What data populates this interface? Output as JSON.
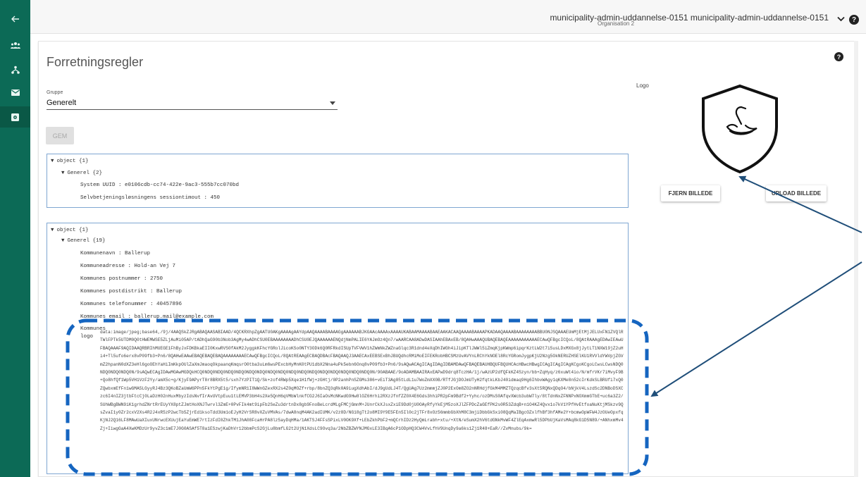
{
  "header": {
    "user_name": "municipality-admin-uddannelse-0151 municipality-admin-uddannelse-0151",
    "organisation": "Organisation 2",
    "help_label": "?"
  },
  "nav": {
    "items": [
      {
        "icon": "back-arrow-icon"
      },
      {
        "icon": "users-icon"
      },
      {
        "icon": "org-tree-icon"
      },
      {
        "icon": "mail-icon"
      },
      {
        "icon": "settings-icon",
        "active": true
      }
    ]
  },
  "page": {
    "title": "Forretningsregler",
    "help_label": "?",
    "group_label": "Gruppe",
    "group_value": "Generelt",
    "save_label": "GEM"
  },
  "panel1": {
    "root": "object {1}",
    "group": "Generel {2}",
    "rows": [
      "System UUID :  e0106cdb-cc74-422e-9ac3-555b7cc070bd",
      "Selvbetjeningsløsningens sessiontimout : 450"
    ]
  },
  "panel2": {
    "root": "object {1}",
    "group": "Generel {19}",
    "rows": [
      "Kommunenavn : Ballerup",
      "Kommuneadresse : Hold-an Vej 7",
      "Kommunes postnummer : 2750",
      "Kommunes postdistrikt : Ballerup",
      "Kommunes telefonummer : 40457896",
      "Kommunes email : ballerup.mail@example.com"
    ],
    "logo_key": "Kommunes logo",
    "logo_value": "data:image/jpeg;base64,/9j/4AAQSkZJRgABAQAASABIAAD/4QCKRXhpZgAATU0AKgAAAAgAAYdpAAQAAAABAAAAGgAAAAAABJKGAAcAAAAxAAAAUKABAAMAAAABAAEAAKACAAQAAAABAAAAPKADAAQAAAABAAAAAAAABBU0NJSQAAAEUmMjEtMjJELUxFN1ZVQlRTWlFPTk5UTDM0Q0tHWEMWSE5ZLjAuMi05AP/tADhQaG90b3Nob3AgMy4wADhCSU0EBAAAAAAAADhCSU0EJQAAAAAAENQdjNmPALIE6YAJmOz4Qn7/wAARCAA8ADwDASIAAhEBAxEB/8QAHwAAAQUBAQEBAQEAAAAAAAAAAAECAwQFBgcICQoL/8QAtRAAAgEDAwIEAwUFBAQAAAF9AQIDAAQRBRIhMUEGE1FhByJxFDKBkaEII0KxwRVS0fAkM2JyggkKFhcYGRolJicoKSo0NTY3ODk6Q0RFRkdISUpTVFVWV1hZWmNkZWZnaGlqc3R1dnd4eXqDhIWGh4iJipKTlJWWl5iZmqKjpKWmp6ipqrKztLW2t7i5usLDxMXGx8jJytLT1NXW19jZ2uHi4+Tl5ufo6erx8vP09fb3+Pn6/8QAHwEAAwEBAQEBAQEBAQAAAAAAAAECAwQFBgcICQoL/8QAtREAAgECBAQDBAcFBAQAAQJ3AAECAxEEBSExBhJBUQdhcRMiMoEIFEKRobHBCSMzUvAVYnLRChYkNOEl8RcYGRomJygpKjU2Nzg5OkNERUZHSElKU1RVVldYWVpjZGVmZ2hpanN0dXZ3eHl6goOEhYaHiImKkpOUlZaXmJmaoqOkpaanqKmqsrO0tba3uLm6wsPExcbHyMnK0tPU1dbX2Nna4uPk5ebn6Onq8vP09fb3+Pn6/9sAQwACAgICAgIDAgIDBAMDAwQFBAQEBAUHBQUFBQUHCAcHBwcHBwgICAgICAgICAgKCgoKCgoLCwsLCwsNDQ0NDQ0NDQ0NDQ0N/9sAQwECAgIDAwMGAwMGDQkHCQ0NDQ0NDQ0NDQ0NDQ0NDQ0NDQ0NDQ0NDQ0NDQ0NDQ0NDQ0NDQ0NDQ0NDQ0NDQ0NDQ0N/90ABAAE/9oADAMBAAIRAxEAPwD9drq8TczHA/1j/wAzUP2dfQFkKZ4Szyn/bb+ZqHyq/z6xuWt4io/N/mfrVKr7iMvyF9B+Qo8hfQf1Wp5VH1VzF2Yy/amX5c+g/KjyF9APyrT8r8BRX5t5/sxh7YzPIT1Q/Sk+zof4RWp5Xqe1H1fWj+zGHtj/0P2anhPnSZGMs386+vEiT3Ag85tLdL1u7WoZmXX0B/RTfJGjDOJmUTyH2fqtkLKbJ40idmaq9Hg6IhbvWAgy1qKXMe8n52cIrKdkSLBRUfi7xQ0ZQwbxmEfFn1wGMA5LGyyRJ4Bz3QKoBZaUmW6PPn5FkYtPgE1g/IfymNR1I8WWnGZexRX2s4Z0qMOZf+rbp/8bnZQ3qRk0A9iugXdhAbI/dJ9gUdLJ4T/QgUAg7Uz2mmmjZJ0P2ExOm8ZO2nNRHdjfGkM4MMZTQzqcBfv3sXt5RQNxQDqO4/bNjkV4LszdSc2DNBoDSXCzc6I4nIZ3jtbFtcCj0LaDzH02nHuxMbyzIdsNvfIrAvUVtpEuu1tLEMVP3bH4s2Xe5QnH6qVMbWlnkfCG2J6IaOsMcNKwdG9Hw8lOZ6Hrhi2RXzJfnfZZ0X4E6Gds3hhiPR2pFm9Bdf2+Yyhc/ozDMsS0AfqvXWcb3ubW7ly/8tTdnNxZFNNPxNOXmmGTbE+uc6a3Z2/SUhWBgBWN9iK1grhdZNrtRrEUyYX8ptZJmtHoXNJTwrvl3ZmE+0PvFIk4mt9ipFb2SeZu3drtnDx8gb9FnoBeLcrdMLgFMCjGmnM+JUnrCkXJsxZxiE9Dd0jU0OAyRfyYkEjM5zoXJlZFPDcZaGEfPK2s0R53ZdqB+n1O4KZ4Qvx1o7kV1YPfHvEtfoaNuKtjMSkzv9QsZvaI1y0Zr2cxV2Xs4R2J4xR5zP2wcTb5ZjrEd1ksoTdd3Um1oEJyH2VrSR8vXZuVMVAs/7dwA8nqM4AK2adIUMK/v2z8D/NG18gTt2o8MI9Y9E5FEn5Il0c2jTFr8xOz56mmbGbXhM8C3mjiDbbGkSxi08QqMaIBgcOZxlfhBf3hfAMe2Y+bcmwOpWFW4JzOUeOpxfqKjNJ2Q16LF8MAwUaXIuxUNrwcEXUujEaYuEmWE7rtIzFdI0ZhkTM1JhA08FcaHrPA8lz5ayDqHMa/1AKTSJ4FFsSPixLV0OK9Xf+LEbZkhPbF2+mQCrhIDz2HyQmLrabh+xtu/+XtN/eSumX2hV6tdGNkMvWF4ZlEqAxmwRl5DPbUjKaVsMAq8kG1D5N89/+ANhxmMv4Zj+IiwgGaA4XwKMDzUr9yvZ3c1mE7J0G0ASAf5T8a1ESzwjKaDhVr12bbmPcS2GjLu8bmfLG2t2UjN1XdsLC9Ovq3a/2NbZBZWYNJMGxLE3IBqA6cP1ODpHQ3CW4VvLfhV9UnqDy9a6ks1Zj1R48+EaR//Z",
    "overflow": "vMnubs/9k="
  }
}
